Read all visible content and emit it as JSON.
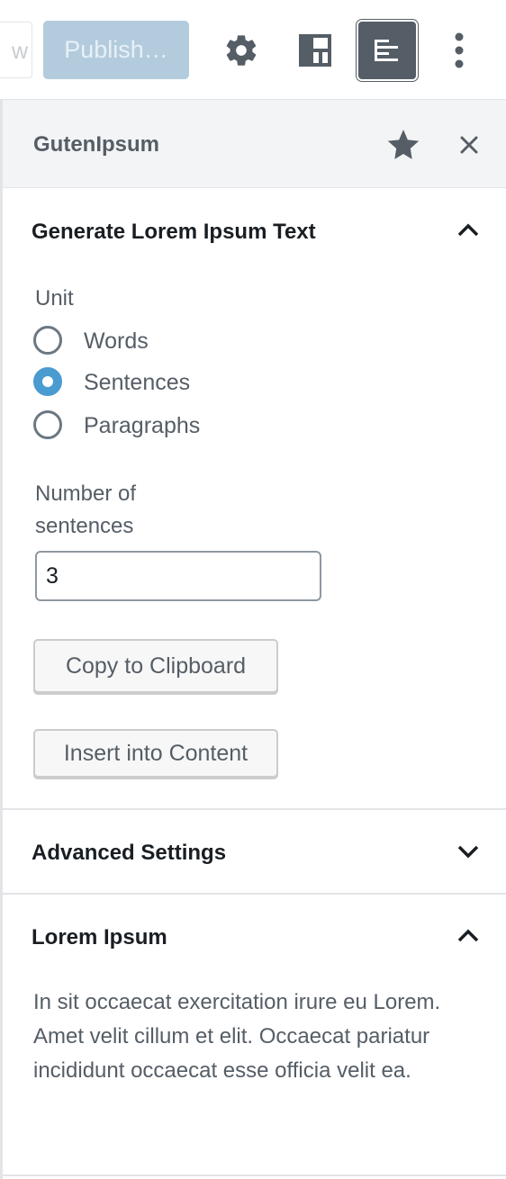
{
  "toolbar": {
    "preview_label": "w",
    "publish_label": "Publish…",
    "settings_icon": "gear-icon",
    "blocks_icon": "block-navigation-icon",
    "sidebar_icon": "sidebar-plugin-icon",
    "more_icon": "more-vertical-icon"
  },
  "sidebar": {
    "title": "GutenIpsum",
    "star_icon": "star-filled-icon",
    "close_icon": "close-icon"
  },
  "generate_panel": {
    "title": "Generate Lorem Ipsum Text",
    "expanded": true,
    "unit_label": "Unit",
    "units": [
      {
        "label": "Words",
        "checked": false
      },
      {
        "label": "Sentences",
        "checked": true
      },
      {
        "label": "Paragraphs",
        "checked": false
      }
    ],
    "number_label_line1": "Number of",
    "number_label_line2": "sentences",
    "number_value": "3",
    "copy_button": "Copy to Clipboard",
    "insert_button": "Insert into Content"
  },
  "advanced_panel": {
    "title": "Advanced Settings",
    "expanded": false
  },
  "lorem_panel": {
    "title": "Lorem Ipsum",
    "expanded": true,
    "text": "In sit occaecat exercitation irure eu Lorem. Amet velit cillum et elit. Occaecat pariatur incididunt occaecat esse officia velit ea."
  },
  "colors": {
    "accent": "#4a9bd0",
    "publish_bg": "#b3ccdd",
    "active_toggle": "#555d66"
  }
}
